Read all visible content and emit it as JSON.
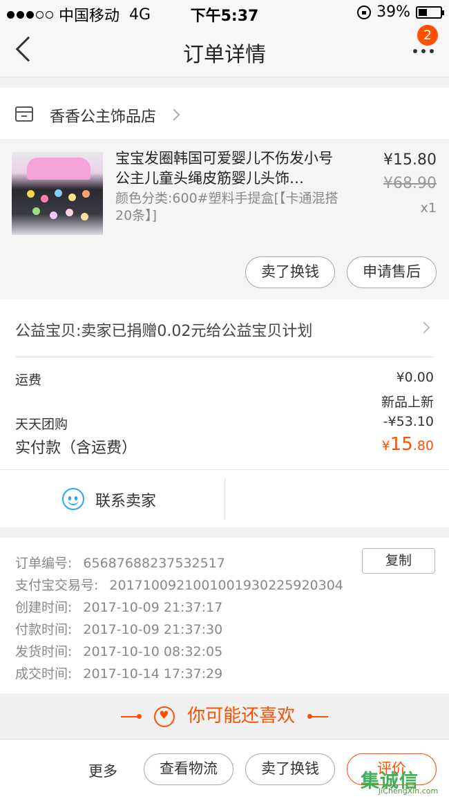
{
  "status_bar": {
    "carrier": "中国移动",
    "network": "4G",
    "time": "下午5:37",
    "battery": "39%",
    "battery_level": 0.39
  },
  "nav": {
    "title": "订单详情",
    "badge_count": "2"
  },
  "shop": {
    "name": "香香公主饰品店"
  },
  "product": {
    "title": "宝宝发圈韩国可爱婴儿不伤发小号公主儿童头绳皮筋婴儿头饰…",
    "sku": "颜色分类:600#塑料手提盒[【卡通混搭20条】]",
    "price": "¥15.80",
    "original_price": "¥68.90",
    "quantity": "x1",
    "buttons": {
      "sell": "卖了换钱",
      "after_sale": "申请售后"
    }
  },
  "charity": {
    "text": "公益宝贝:卖家已捐赠0.02元给公益宝贝计划"
  },
  "fees": {
    "shipping_label": "运费",
    "shipping_value": "¥0.00",
    "promo_title": "新品上新",
    "group_label": "天天团购",
    "group_value": "-¥53.10",
    "paid_label": "实付款（含运费）",
    "paid_currency": "¥",
    "paid_int": "15",
    "paid_dec": ".80"
  },
  "contact": {
    "label": "联系卖家"
  },
  "order_info": {
    "copy_label": "复制",
    "rows": [
      {
        "label": "订单编号:",
        "value": "65687688237532517"
      },
      {
        "label": "支付宝交易号:",
        "value": "2017100921001001930225920304"
      },
      {
        "label": "创建时间:",
        "value": "2017-10-09 21:37:17"
      },
      {
        "label": "付款时间:",
        "value": "2017-10-09 21:37:30"
      },
      {
        "label": "发货时间:",
        "value": "2017-10-10 08:32:05"
      },
      {
        "label": "成交时间:",
        "value": "2017-10-14 17:37:29"
      }
    ]
  },
  "recommend": {
    "title": "你可能还喜欢"
  },
  "bottom_bar": {
    "more": "更多",
    "logistics": "查看物流",
    "sell": "卖了换钱",
    "review": "评价"
  },
  "watermark": {
    "text": "集诚信",
    "url": "JiChengXin.com"
  },
  "colors": {
    "accent": "#ff5000",
    "contact_icon": "#28a5ff"
  }
}
